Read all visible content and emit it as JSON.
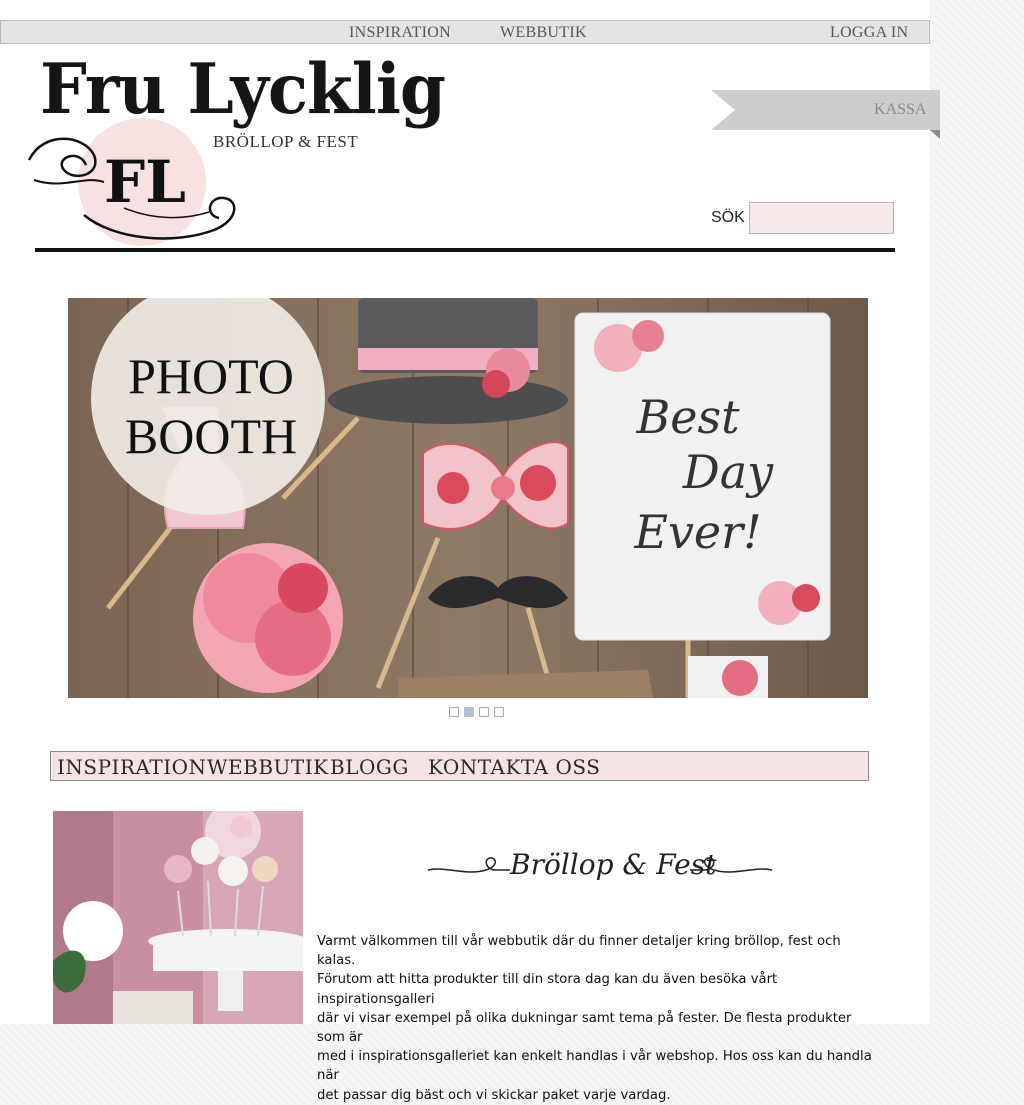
{
  "topnav": {
    "inspiration": "INSPIRATION",
    "webbutik": "WEBBUTIK",
    "login": "LOGGA IN"
  },
  "logo": {
    "title": "Fru Lycklig",
    "subtitle": "BRÖLLOP & FEST",
    "monogram": "FL"
  },
  "cart": {
    "label": "KASSA"
  },
  "search": {
    "label": "SÖK",
    "value": ""
  },
  "hero": {
    "badge_line1": "PHOTO",
    "badge_line2": "BOOTH",
    "sign_line1": "Best",
    "sign_line2": "Day",
    "sign_line3": "Ever!"
  },
  "slider": {
    "count": 4,
    "active": 1
  },
  "mainnav": {
    "item1": "INSPIRATION",
    "item2": "WEBBUTIK",
    "item3": "BLOGG",
    "item4": "KONTAKTA OSS"
  },
  "content": {
    "heading": "Bröllop & Fest",
    "line1": "Varmt välkommen till vår webbutik där du finner detaljer kring bröllop, fest och kalas.",
    "line2": "Förutom att hitta produkter till din stora dag kan du även besöka vårt inspirationsgalleri",
    "line3": "där vi visar exempel på olika dukningar samt tema på fester. De flesta produkter som är",
    "line4": "med i inspirationsgalleriet kan enkelt handlas i vår webshop. Hos oss kan du handla när",
    "line5": "det passar dig bäst och vi skickar paket varje vardag."
  },
  "colors": {
    "accent_pink": "#f6e4e4",
    "topbar_gray": "#e4e4e4",
    "ribbon_gray": "#cdcdcd"
  }
}
